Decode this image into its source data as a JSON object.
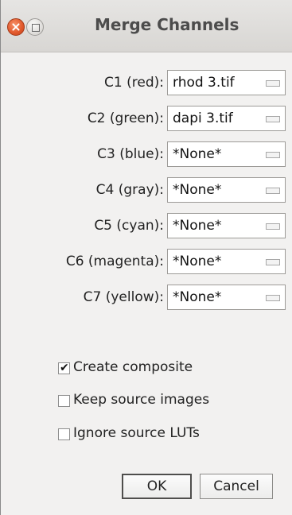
{
  "window": {
    "title": "Merge Channels"
  },
  "channels": [
    {
      "label": "C1 (red):",
      "value": "rhod 3.tif"
    },
    {
      "label": "C2 (green):",
      "value": "dapi 3.tif"
    },
    {
      "label": "C3 (blue):",
      "value": "*None*"
    },
    {
      "label": "C4 (gray):",
      "value": "*None*"
    },
    {
      "label": "C5 (cyan):",
      "value": "*None*"
    },
    {
      "label": "C6 (magenta):",
      "value": "*None*"
    },
    {
      "label": "C7 (yellow):",
      "value": "*None*"
    }
  ],
  "options": [
    {
      "label": "Create composite",
      "checked": true
    },
    {
      "label": "Keep source images",
      "checked": false
    },
    {
      "label": "Ignore source LUTs",
      "checked": false
    }
  ],
  "buttons": {
    "ok": "OK",
    "cancel": "Cancel"
  }
}
